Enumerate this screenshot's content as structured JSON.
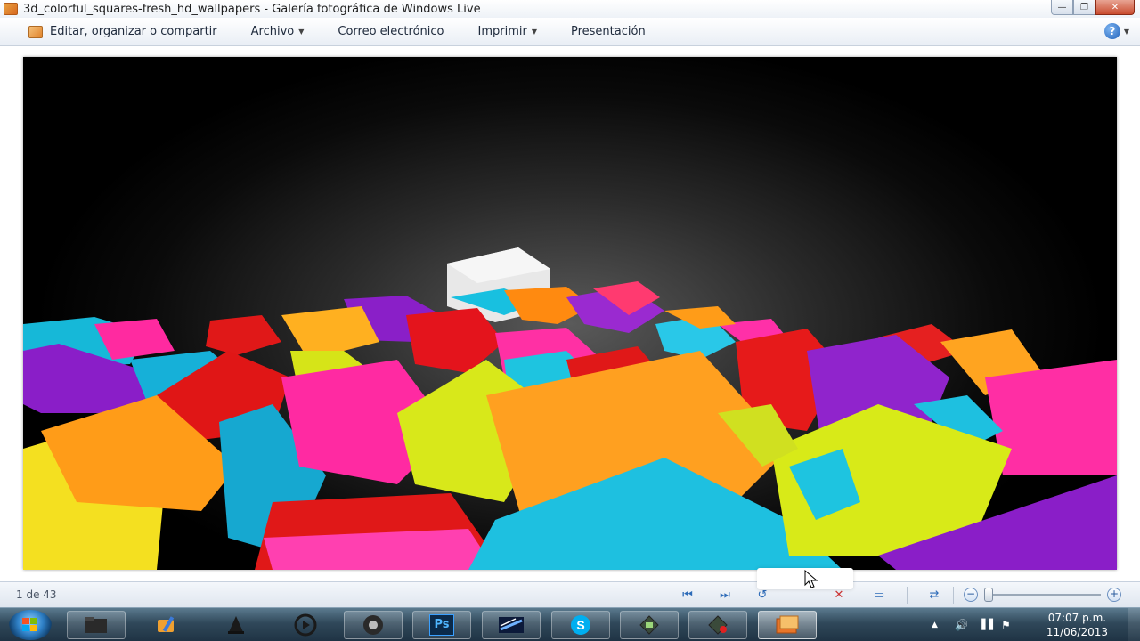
{
  "window": {
    "title": "3d_colorful_squares-fresh_hd_wallpapers - Galería fotográfica de Windows Live",
    "app_icon": "photo-gallery-icon",
    "minimize_icon": "minimize-icon",
    "maximize_icon": "restore-icon",
    "close_icon": "close-icon"
  },
  "toolbar": {
    "edit_label": "Editar, organizar o compartir",
    "file_label": "Archivo",
    "email_label": "Correo electrónico",
    "print_label": "Imprimir",
    "slideshow_label": "Presentación",
    "help_icon": "help-icon"
  },
  "viewer": {
    "image_name": "3d_colorful_squares-fresh_hd_wallpapers",
    "counter": "1 de 43"
  },
  "navigation": {
    "controls": [
      "previous-icon",
      "next-icon",
      "rotate-left-icon",
      "delete-icon",
      "slideshow-icon",
      "actual-size-icon",
      "zoom-out-icon",
      "zoom-in-icon"
    ]
  },
  "taskbar": {
    "start_icon": "windows-start-icon",
    "items": [
      {
        "name": "explorer-icon"
      },
      {
        "name": "paint-icon"
      },
      {
        "name": "vlc-icon"
      },
      {
        "name": "media-player-icon"
      },
      {
        "name": "chrome-icon"
      },
      {
        "name": "photoshop-icon",
        "label": "Ps"
      },
      {
        "name": "sony-vegas-icon"
      },
      {
        "name": "skype-icon"
      },
      {
        "name": "screen-recorder-icon"
      },
      {
        "name": "screen-recorder-2-icon"
      },
      {
        "name": "photo-gallery-icon"
      }
    ],
    "clock": {
      "time": "07:07 p.m.",
      "date": "11/06/2013"
    }
  },
  "colors": {
    "titlebar": "#eef2f7",
    "accent": "#2d6bb8",
    "taskbar": "#30485a"
  }
}
